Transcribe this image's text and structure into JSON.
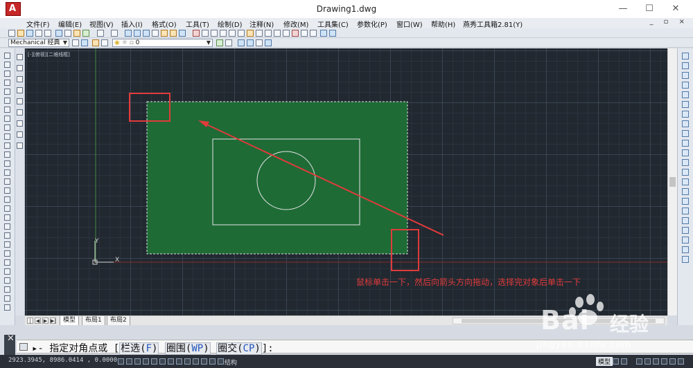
{
  "window": {
    "title": "Drawing1.dwg",
    "logo_letter": "A",
    "minimize": "—",
    "maximize": "☐",
    "close": "✕"
  },
  "menu": {
    "items": [
      "文件(F)",
      "编辑(E)",
      "视图(V)",
      "插入(I)",
      "格式(O)",
      "工具(T)",
      "绘制(D)",
      "注释(N)",
      "修改(M)",
      "工具集(C)",
      "参数化(P)",
      "窗口(W)",
      "帮助(H)",
      "燕秀工具箱2.81(Y)"
    ],
    "right_controls": "_ ▫ ×"
  },
  "toolbar": {
    "workspace": "Mechanical 经典",
    "layer_value": "0"
  },
  "viewport": {
    "label": "[-][俯视][二维线框]"
  },
  "annotation": {
    "text": "鼠标单击一下，然后向箭头方向拖动，选择完对象后单击一下"
  },
  "axes": {
    "x": "X",
    "y": "Y"
  },
  "tabs": {
    "model": "模型",
    "layout1": "布局1",
    "layout2": "布局2",
    "nav": [
      "|◀",
      "◀",
      "▶",
      "▶|"
    ]
  },
  "command": {
    "prompt_prefix": "▸- 指定对角点或 [",
    "opt1_label": "栏选(",
    "opt1_key": "F",
    "opt2_label": "圈围(",
    "opt2_key": "WP",
    "opt3_label": "圈交(",
    "opt3_key": "CP",
    "prompt_suffix": "]:",
    "close_icon": "✕"
  },
  "status": {
    "coords": "2923.3945,  8986.0414 , 0.0000",
    "struct": "结构",
    "model": "模型"
  },
  "watermark": {
    "brand": "Bai",
    "brand2": "经验",
    "url": "jingyan.baidu.com"
  },
  "colors": {
    "canvas_bg": "#212830",
    "selection_fill": "#1e6b36",
    "pick_box": "#e03b3b",
    "arrow": "#e03b3b",
    "annotation_text": "#e03b3b"
  }
}
